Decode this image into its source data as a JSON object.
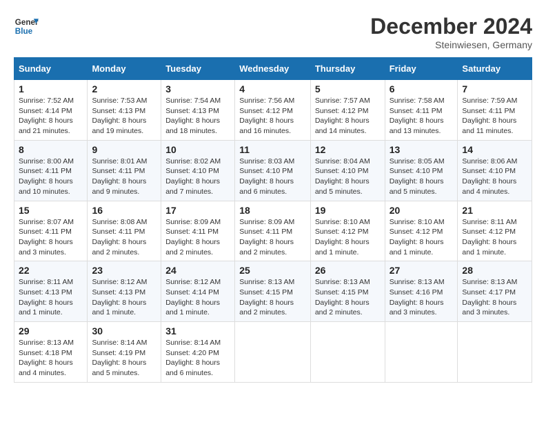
{
  "header": {
    "logo_line1": "General",
    "logo_line2": "Blue",
    "month": "December 2024",
    "location": "Steinwiesen, Germany"
  },
  "columns": [
    "Sunday",
    "Monday",
    "Tuesday",
    "Wednesday",
    "Thursday",
    "Friday",
    "Saturday"
  ],
  "weeks": [
    [
      {
        "day": "1",
        "sunrise": "7:52 AM",
        "sunset": "4:14 PM",
        "daylight": "8 hours and 21 minutes."
      },
      {
        "day": "2",
        "sunrise": "7:53 AM",
        "sunset": "4:13 PM",
        "daylight": "8 hours and 19 minutes."
      },
      {
        "day": "3",
        "sunrise": "7:54 AM",
        "sunset": "4:13 PM",
        "daylight": "8 hours and 18 minutes."
      },
      {
        "day": "4",
        "sunrise": "7:56 AM",
        "sunset": "4:12 PM",
        "daylight": "8 hours and 16 minutes."
      },
      {
        "day": "5",
        "sunrise": "7:57 AM",
        "sunset": "4:12 PM",
        "daylight": "8 hours and 14 minutes."
      },
      {
        "day": "6",
        "sunrise": "7:58 AM",
        "sunset": "4:11 PM",
        "daylight": "8 hours and 13 minutes."
      },
      {
        "day": "7",
        "sunrise": "7:59 AM",
        "sunset": "4:11 PM",
        "daylight": "8 hours and 11 minutes."
      }
    ],
    [
      {
        "day": "8",
        "sunrise": "8:00 AM",
        "sunset": "4:11 PM",
        "daylight": "8 hours and 10 minutes."
      },
      {
        "day": "9",
        "sunrise": "8:01 AM",
        "sunset": "4:11 PM",
        "daylight": "8 hours and 9 minutes."
      },
      {
        "day": "10",
        "sunrise": "8:02 AM",
        "sunset": "4:10 PM",
        "daylight": "8 hours and 7 minutes."
      },
      {
        "day": "11",
        "sunrise": "8:03 AM",
        "sunset": "4:10 PM",
        "daylight": "8 hours and 6 minutes."
      },
      {
        "day": "12",
        "sunrise": "8:04 AM",
        "sunset": "4:10 PM",
        "daylight": "8 hours and 5 minutes."
      },
      {
        "day": "13",
        "sunrise": "8:05 AM",
        "sunset": "4:10 PM",
        "daylight": "8 hours and 5 minutes."
      },
      {
        "day": "14",
        "sunrise": "8:06 AM",
        "sunset": "4:10 PM",
        "daylight": "8 hours and 4 minutes."
      }
    ],
    [
      {
        "day": "15",
        "sunrise": "8:07 AM",
        "sunset": "4:11 PM",
        "daylight": "8 hours and 3 minutes."
      },
      {
        "day": "16",
        "sunrise": "8:08 AM",
        "sunset": "4:11 PM",
        "daylight": "8 hours and 2 minutes."
      },
      {
        "day": "17",
        "sunrise": "8:09 AM",
        "sunset": "4:11 PM",
        "daylight": "8 hours and 2 minutes."
      },
      {
        "day": "18",
        "sunrise": "8:09 AM",
        "sunset": "4:11 PM",
        "daylight": "8 hours and 2 minutes."
      },
      {
        "day": "19",
        "sunrise": "8:10 AM",
        "sunset": "4:12 PM",
        "daylight": "8 hours and 1 minute."
      },
      {
        "day": "20",
        "sunrise": "8:10 AM",
        "sunset": "4:12 PM",
        "daylight": "8 hours and 1 minute."
      },
      {
        "day": "21",
        "sunrise": "8:11 AM",
        "sunset": "4:12 PM",
        "daylight": "8 hours and 1 minute."
      }
    ],
    [
      {
        "day": "22",
        "sunrise": "8:11 AM",
        "sunset": "4:13 PM",
        "daylight": "8 hours and 1 minute."
      },
      {
        "day": "23",
        "sunrise": "8:12 AM",
        "sunset": "4:13 PM",
        "daylight": "8 hours and 1 minute."
      },
      {
        "day": "24",
        "sunrise": "8:12 AM",
        "sunset": "4:14 PM",
        "daylight": "8 hours and 1 minute."
      },
      {
        "day": "25",
        "sunrise": "8:13 AM",
        "sunset": "4:15 PM",
        "daylight": "8 hours and 2 minutes."
      },
      {
        "day": "26",
        "sunrise": "8:13 AM",
        "sunset": "4:15 PM",
        "daylight": "8 hours and 2 minutes."
      },
      {
        "day": "27",
        "sunrise": "8:13 AM",
        "sunset": "4:16 PM",
        "daylight": "8 hours and 3 minutes."
      },
      {
        "day": "28",
        "sunrise": "8:13 AM",
        "sunset": "4:17 PM",
        "daylight": "8 hours and 3 minutes."
      }
    ],
    [
      {
        "day": "29",
        "sunrise": "8:13 AM",
        "sunset": "4:18 PM",
        "daylight": "8 hours and 4 minutes."
      },
      {
        "day": "30",
        "sunrise": "8:14 AM",
        "sunset": "4:19 PM",
        "daylight": "8 hours and 5 minutes."
      },
      {
        "day": "31",
        "sunrise": "8:14 AM",
        "sunset": "4:20 PM",
        "daylight": "8 hours and 6 minutes."
      },
      null,
      null,
      null,
      null
    ]
  ]
}
